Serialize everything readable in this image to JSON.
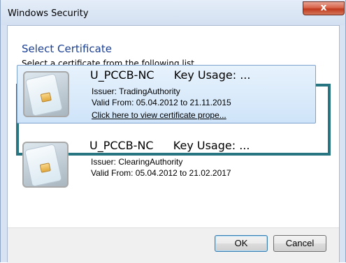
{
  "window": {
    "title": "Windows Security",
    "close_glyph": "x"
  },
  "dialog": {
    "heading": "Select Certificate",
    "subheading": "Select a certificate from the following list"
  },
  "certificates": [
    {
      "name": "U_PCCB-NC",
      "key_usage": "Key Usage: ...",
      "issuer": "Issuer: TradingAuthority",
      "valid": "Valid From: 05.04.2012 to 21.11.2015",
      "link": "Click here to view certificate prope...",
      "icon": "smart-card-icon"
    },
    {
      "name": "U_PCCB-NC",
      "key_usage": "Key Usage: ...",
      "issuer": "Issuer: ClearingAuthority",
      "valid": "Valid From: 05.04.2012 to 21.02.2017",
      "icon": "smart-card-icon"
    }
  ],
  "buttons": {
    "ok": "OK",
    "cancel": "Cancel"
  },
  "colors": {
    "heading": "#1a3f93",
    "highlight_border": "#267581",
    "selection_bg": "#cfe4f9"
  }
}
